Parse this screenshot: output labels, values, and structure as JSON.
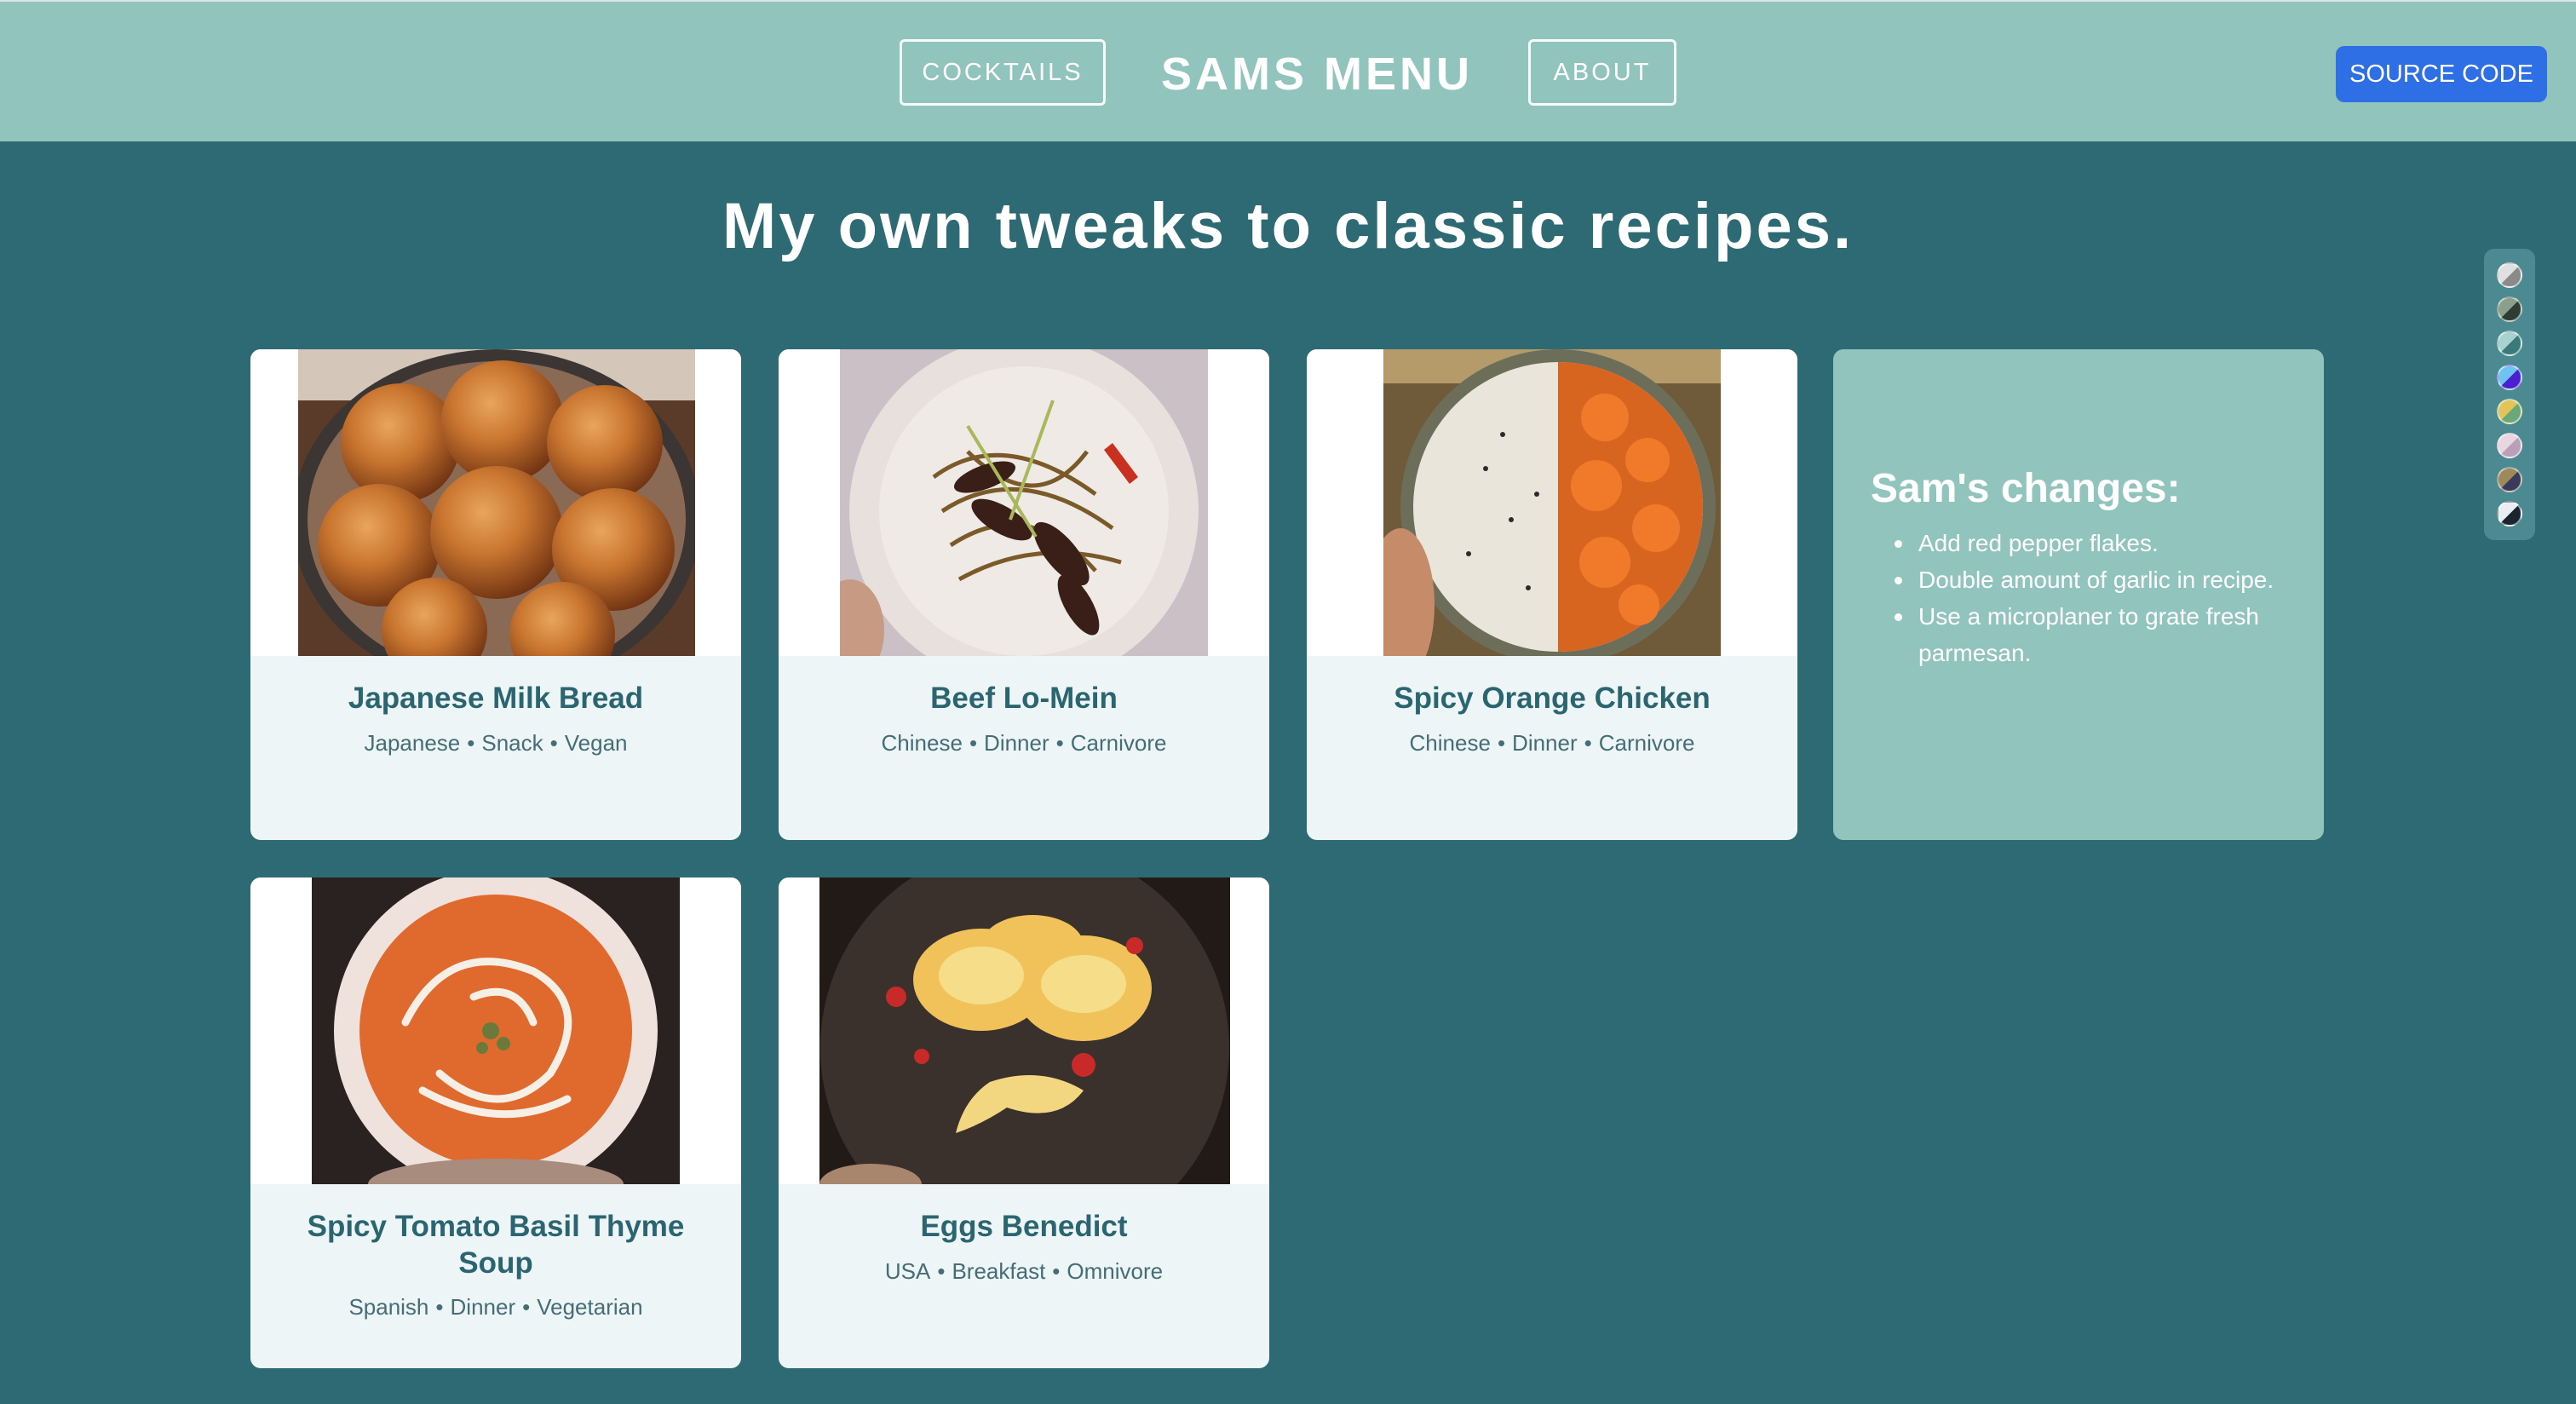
{
  "header": {
    "nav_left": "COCKTAILS",
    "brand": "SAMS MENU",
    "nav_right": "ABOUT",
    "source_button": "SOURCE CODE"
  },
  "hero": {
    "title": "My own tweaks to classic recipes."
  },
  "recipes": [
    {
      "title": "Japanese Milk Bread",
      "tags": [
        "Japanese",
        "Snack",
        "Vegan"
      ],
      "image": "milk-bread-photo"
    },
    {
      "title": "Beef Lo-Mein",
      "tags": [
        "Chinese",
        "Dinner",
        "Carnivore"
      ],
      "image": "lo-mein-photo"
    },
    {
      "title": "Spicy Orange Chicken",
      "tags": [
        "Chinese",
        "Dinner",
        "Carnivore"
      ],
      "image": "orange-chicken-photo"
    },
    {
      "title": "Spicy Tomato Basil Thyme Soup",
      "tags": [
        "Spanish",
        "Dinner",
        "Vegetarian"
      ],
      "image": "tomato-soup-photo"
    },
    {
      "title": "Eggs Benedict",
      "tags": [
        "USA",
        "Breakfast",
        "Omnivore"
      ],
      "image": "eggs-benedict-photo"
    }
  ],
  "changes": {
    "title": "Sam's changes:",
    "items": [
      "Add red pepper flakes.",
      "Double amount of garlic in recipe.",
      "Use a microplaner to grate fresh parmesan."
    ]
  },
  "colors": {
    "header_bg": "#92c4be",
    "page_bg": "#2e6a74",
    "card_bg": "#edf5f7",
    "source_button": "#2f6fe6",
    "title_text": "#2b6570"
  },
  "theme_swatches": [
    "#c9c9c9",
    "#4f6b5a",
    "#6aa6a6",
    "#5b2fd6",
    "#c9b05a",
    "#d9c0cf",
    "#4a5a6a",
    "#1f2a33"
  ]
}
